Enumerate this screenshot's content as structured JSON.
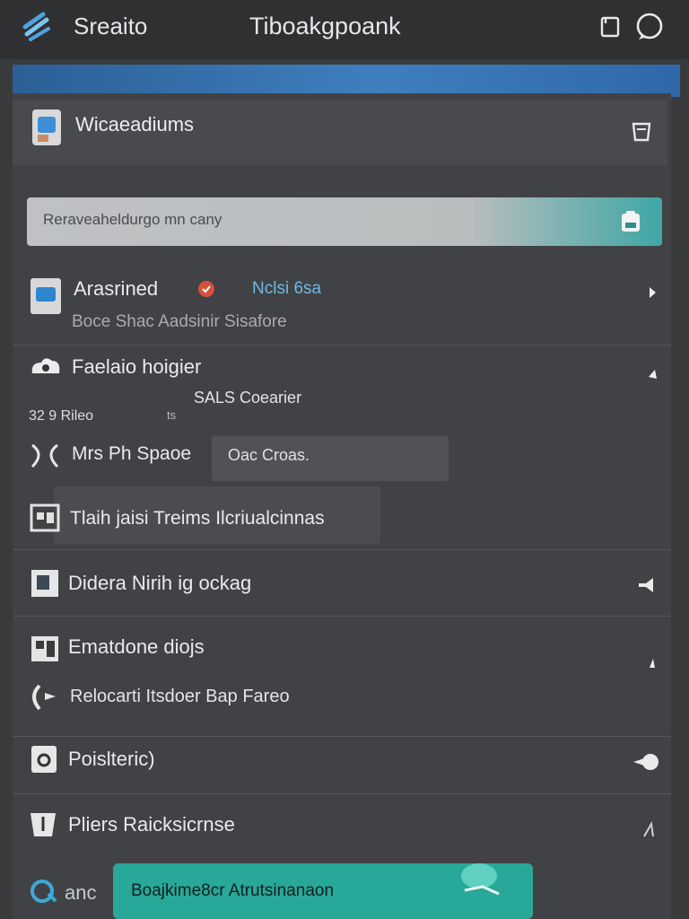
{
  "topbar": {
    "app_name": "Sreaito",
    "title": "Tiboakgpoank",
    "icons": [
      "menu-icon",
      "document-icon",
      "chat-icon"
    ]
  },
  "card": {
    "title": "Wicaeadiums",
    "icons": [
      "profile-icon",
      "bag-icon"
    ]
  },
  "search": {
    "text": "Reraveaheldurgo mn cany",
    "icon": "clipboard-icon"
  },
  "rows": [
    {
      "title": "Arasrined",
      "tag": "Nclsi 6sa",
      "subtitle": "Boce Shac Aadsinir Sisafore"
    },
    {
      "title": "Faelaio hoigier",
      "subtitle": "SALS Coearier",
      "extra": "32 9 Rileo",
      "extra2": "ts"
    },
    {
      "title": "Mrs Ph Spaoe",
      "chip": "Oac Croas."
    },
    {
      "title": "Tlaih jaisi Treims Ilcriualcinnas"
    },
    {
      "title": "Didera Nirih ig ockag"
    },
    {
      "title": "Ematdone diojs",
      "subtitle": "Relocarti Itsdoer Bap Fareo"
    },
    {
      "title": "Poislteric)"
    },
    {
      "title": "Pliers Raicksicrnse"
    }
  ],
  "bottom": {
    "left_label": "anc",
    "fab_label": "Boajkime8cr Atrutsinanaon"
  },
  "colors": {
    "background": "#3a3b3d",
    "topbar": "#2f3032",
    "accent_blue": "#3f7fbf",
    "accent_teal": "#28a898",
    "tag_blue": "#6fb8e6"
  }
}
